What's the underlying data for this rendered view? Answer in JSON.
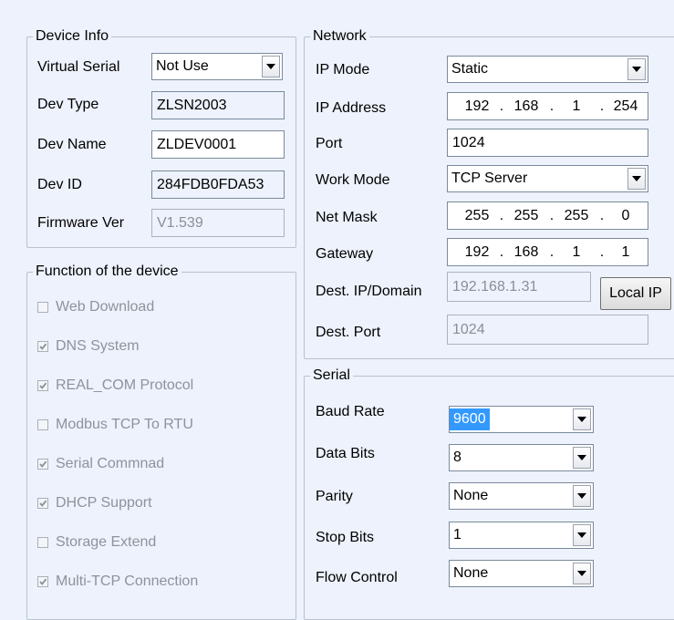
{
  "device_info": {
    "legend": "Device Info",
    "virtual_serial": {
      "label": "Virtual Serial",
      "value": "Not Use"
    },
    "dev_type": {
      "label": "Dev Type",
      "value": "ZLSN2003"
    },
    "dev_name": {
      "label": "Dev Name",
      "value": "ZLDEV0001"
    },
    "dev_id": {
      "label": "Dev ID",
      "value": "284FDB0FDA53"
    },
    "firmware": {
      "label": "Firmware Ver",
      "value": "V1.539"
    }
  },
  "functions": {
    "legend": "Function of the device",
    "items": [
      {
        "label": "Web Download",
        "checked": false
      },
      {
        "label": "DNS System",
        "checked": true
      },
      {
        "label": "REAL_COM Protocol",
        "checked": true
      },
      {
        "label": "Modbus TCP To RTU",
        "checked": false
      },
      {
        "label": "Serial Commnad",
        "checked": true
      },
      {
        "label": "DHCP Support",
        "checked": true
      },
      {
        "label": "Storage Extend",
        "checked": false
      },
      {
        "label": "Multi-TCP Connection",
        "checked": true
      }
    ]
  },
  "network": {
    "legend": "Network",
    "ip_mode": {
      "label": "IP Mode",
      "value": "Static"
    },
    "ip_address": {
      "label": "IP Address",
      "octets": [
        "192",
        "168",
        "1",
        "254"
      ]
    },
    "port": {
      "label": "Port",
      "value": "1024"
    },
    "work_mode": {
      "label": "Work Mode",
      "value": "TCP Server"
    },
    "net_mask": {
      "label": "Net Mask",
      "octets": [
        "255",
        "255",
        "255",
        "0"
      ]
    },
    "gateway": {
      "label": "Gateway",
      "octets": [
        "192",
        "168",
        "1",
        "1"
      ]
    },
    "dest_ip": {
      "label": "Dest. IP/Domain",
      "value": "192.168.1.31"
    },
    "local_ip_button": "Local IP",
    "dest_port": {
      "label": "Dest. Port",
      "value": "1024"
    },
    "dot": "."
  },
  "serial": {
    "legend": "Serial",
    "baud_rate": {
      "label": "Baud Rate",
      "value": "9600"
    },
    "data_bits": {
      "label": "Data Bits",
      "value": "8"
    },
    "parity": {
      "label": "Parity",
      "value": "None"
    },
    "stop_bits": {
      "label": "Stop Bits",
      "value": "1"
    },
    "flow_control": {
      "label": "Flow Control",
      "value": "None"
    }
  },
  "colors": {
    "background": "#edf2fc",
    "selection": "#3399ff",
    "disabled_text": "#8d939b"
  }
}
